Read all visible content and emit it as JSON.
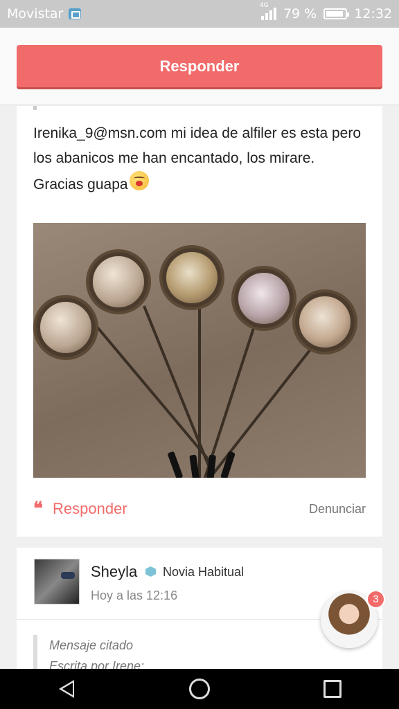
{
  "status_bar": {
    "carrier": "Movistar",
    "network": "4G",
    "battery": "79 %",
    "time": "12:32"
  },
  "header": {
    "reply_button": "Responder"
  },
  "post": {
    "text": "Irenika_9@msn.com mi idea de alfiler es esta pero los abanicos me han encantado, los mirare. Gracias guapa",
    "reply_label": "Responder",
    "report_label": "Denunciar"
  },
  "next_post": {
    "username": "Sheyla",
    "rank": "Novia Habitual",
    "timestamp": "Hoy a las 12:16",
    "quote_title": "Mensaje citado",
    "quote_author": "Escrita por Irene:"
  },
  "chat": {
    "badge_count": "3"
  },
  "icons": {
    "quote": "quote-icon",
    "back": "back-icon",
    "home": "home-icon",
    "recents": "recents-icon"
  },
  "colors": {
    "accent": "#f26b6b",
    "status_bar": "#c9c9c9"
  }
}
